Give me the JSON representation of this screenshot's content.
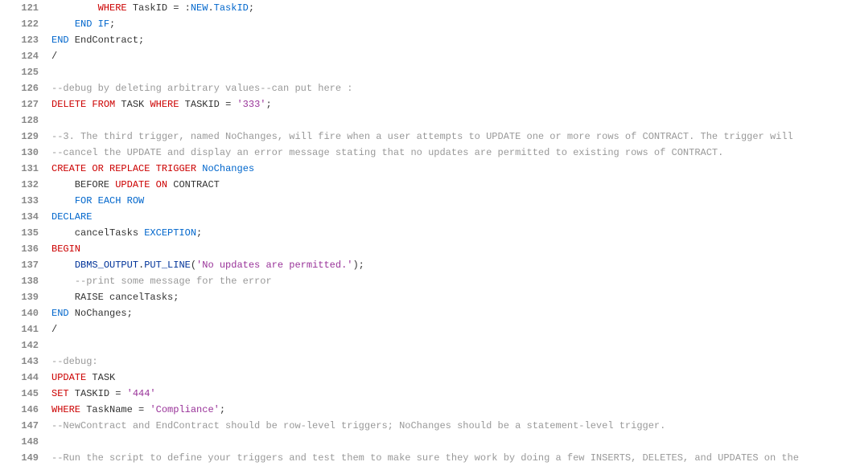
{
  "lines": [
    {
      "num": "121",
      "tokens": [
        {
          "t": "        ",
          "c": ""
        },
        {
          "t": "WHERE",
          "c": "kw-red"
        },
        {
          "t": " TaskID ",
          "c": ""
        },
        {
          "t": "=",
          "c": ""
        },
        {
          "t": " :",
          "c": ""
        },
        {
          "t": "NEW",
          "c": "kw-blue"
        },
        {
          "t": ".",
          "c": ""
        },
        {
          "t": "TaskID",
          "c": "kw-blue"
        },
        {
          "t": ";",
          "c": ""
        }
      ]
    },
    {
      "num": "122",
      "tokens": [
        {
          "t": "    ",
          "c": ""
        },
        {
          "t": "END",
          "c": "kw-blue"
        },
        {
          "t": " ",
          "c": ""
        },
        {
          "t": "IF",
          "c": "kw-blue"
        },
        {
          "t": ";",
          "c": ""
        }
      ]
    },
    {
      "num": "123",
      "tokens": [
        {
          "t": "END",
          "c": "kw-blue"
        },
        {
          "t": " EndContract;",
          "c": ""
        }
      ]
    },
    {
      "num": "124",
      "tokens": [
        {
          "t": "/",
          "c": ""
        }
      ]
    },
    {
      "num": "125",
      "tokens": []
    },
    {
      "num": "126",
      "tokens": [
        {
          "t": "--debug by deleting arbitrary values--can put here :",
          "c": "comment"
        }
      ]
    },
    {
      "num": "127",
      "tokens": [
        {
          "t": "DELETE",
          "c": "kw-red"
        },
        {
          "t": " ",
          "c": ""
        },
        {
          "t": "FROM",
          "c": "kw-red"
        },
        {
          "t": " TASK ",
          "c": ""
        },
        {
          "t": "WHERE",
          "c": "kw-red"
        },
        {
          "t": " TASKID ",
          "c": ""
        },
        {
          "t": "=",
          "c": ""
        },
        {
          "t": " ",
          "c": ""
        },
        {
          "t": "'333'",
          "c": "string"
        },
        {
          "t": ";",
          "c": ""
        }
      ]
    },
    {
      "num": "128",
      "tokens": []
    },
    {
      "num": "129",
      "tokens": [
        {
          "t": "--3. The third trigger, named NoChanges, will fire when a user attempts to UPDATE one or more rows of CONTRACT. The trigger will",
          "c": "comment"
        }
      ]
    },
    {
      "num": "130",
      "tokens": [
        {
          "t": "--cancel the UPDATE and display an error message stating that no updates are permitted to existing rows of CONTRACT.",
          "c": "comment"
        }
      ]
    },
    {
      "num": "131",
      "tokens": [
        {
          "t": "CREATE",
          "c": "kw-red"
        },
        {
          "t": " ",
          "c": ""
        },
        {
          "t": "OR",
          "c": "kw-red"
        },
        {
          "t": " ",
          "c": ""
        },
        {
          "t": "REPLACE",
          "c": "kw-red"
        },
        {
          "t": " ",
          "c": ""
        },
        {
          "t": "TRIGGER",
          "c": "kw-red"
        },
        {
          "t": " ",
          "c": ""
        },
        {
          "t": "NoChanges",
          "c": "kw-blue"
        }
      ]
    },
    {
      "num": "132",
      "tokens": [
        {
          "t": "    BEFORE ",
          "c": ""
        },
        {
          "t": "UPDATE",
          "c": "kw-red"
        },
        {
          "t": " ",
          "c": ""
        },
        {
          "t": "ON",
          "c": "kw-red"
        },
        {
          "t": " CONTRACT",
          "c": ""
        }
      ]
    },
    {
      "num": "133",
      "tokens": [
        {
          "t": "    ",
          "c": ""
        },
        {
          "t": "FOR",
          "c": "kw-blue"
        },
        {
          "t": " ",
          "c": ""
        },
        {
          "t": "EACH",
          "c": "kw-blue"
        },
        {
          "t": " ",
          "c": ""
        },
        {
          "t": "ROW",
          "c": "kw-blue"
        }
      ]
    },
    {
      "num": "134",
      "tokens": [
        {
          "t": "DECLARE",
          "c": "kw-blue"
        }
      ]
    },
    {
      "num": "135",
      "tokens": [
        {
          "t": "    cancelTasks ",
          "c": ""
        },
        {
          "t": "EXCEPTION",
          "c": "kw-blue"
        },
        {
          "t": ";",
          "c": ""
        }
      ]
    },
    {
      "num": "136",
      "tokens": [
        {
          "t": "BEGIN",
          "c": "kw-red"
        }
      ]
    },
    {
      "num": "137",
      "tokens": [
        {
          "t": "    ",
          "c": ""
        },
        {
          "t": "DBMS_OUTPUT",
          "c": "kw-darkblue"
        },
        {
          "t": ".",
          "c": ""
        },
        {
          "t": "PUT_LINE",
          "c": "kw-darkblue"
        },
        {
          "t": "(",
          "c": ""
        },
        {
          "t": "'No updates are permitted.'",
          "c": "string"
        },
        {
          "t": ");",
          "c": ""
        }
      ]
    },
    {
      "num": "138",
      "tokens": [
        {
          "t": "    ",
          "c": ""
        },
        {
          "t": "--print some message for the error",
          "c": "comment"
        }
      ]
    },
    {
      "num": "139",
      "tokens": [
        {
          "t": "    RAISE cancelTasks;",
          "c": ""
        }
      ]
    },
    {
      "num": "140",
      "tokens": [
        {
          "t": "END",
          "c": "kw-blue"
        },
        {
          "t": " NoChanges;",
          "c": ""
        }
      ]
    },
    {
      "num": "141",
      "tokens": [
        {
          "t": "/",
          "c": ""
        }
      ]
    },
    {
      "num": "142",
      "tokens": []
    },
    {
      "num": "143",
      "tokens": [
        {
          "t": "--debug:",
          "c": "comment"
        }
      ]
    },
    {
      "num": "144",
      "tokens": [
        {
          "t": "UPDATE",
          "c": "kw-red"
        },
        {
          "t": " TASK",
          "c": ""
        }
      ]
    },
    {
      "num": "145",
      "tokens": [
        {
          "t": "SET",
          "c": "kw-red"
        },
        {
          "t": " TASKID ",
          "c": ""
        },
        {
          "t": "=",
          "c": ""
        },
        {
          "t": " ",
          "c": ""
        },
        {
          "t": "'444'",
          "c": "string"
        }
      ]
    },
    {
      "num": "146",
      "tokens": [
        {
          "t": "WHERE",
          "c": "kw-red"
        },
        {
          "t": " TaskName ",
          "c": ""
        },
        {
          "t": "=",
          "c": ""
        },
        {
          "t": " ",
          "c": ""
        },
        {
          "t": "'Compliance'",
          "c": "string"
        },
        {
          "t": ";",
          "c": ""
        }
      ]
    },
    {
      "num": "147",
      "tokens": [
        {
          "t": "--NewContract and EndContract should be row-level triggers; NoChanges should be a statement-level trigger.",
          "c": "comment"
        }
      ]
    },
    {
      "num": "148",
      "tokens": []
    },
    {
      "num": "149",
      "tokens": [
        {
          "t": "--Run the script to define your triggers and test them to make sure they work by doing a few INSERTS, DELETES, and UPDATES on the",
          "c": "comment"
        }
      ]
    }
  ]
}
